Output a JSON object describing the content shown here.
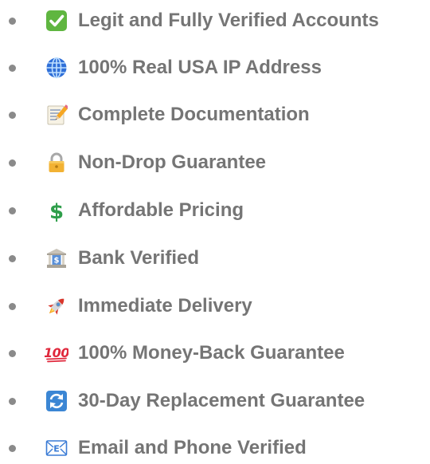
{
  "features": [
    {
      "label": "Legit and Fully Verified Accounts",
      "icon": "check-mark-icon"
    },
    {
      "label": "100% Real USA IP Address",
      "icon": "globe-icon"
    },
    {
      "label": "Complete Documentation",
      "icon": "memo-icon"
    },
    {
      "label": "Non-Drop Guarantee",
      "icon": "lock-icon"
    },
    {
      "label": "Affordable Pricing",
      "icon": "dollar-icon"
    },
    {
      "label": "Bank Verified",
      "icon": "bank-icon"
    },
    {
      "label": "Immediate Delivery",
      "icon": "rocket-icon"
    },
    {
      "label": "100% Money-Back Guarantee",
      "icon": "hundred-points-icon"
    },
    {
      "label": "30-Day Replacement Guarantee",
      "icon": "repeat-arrows-icon"
    },
    {
      "label": "Email and Phone Verified",
      "icon": "email-icon"
    }
  ],
  "colors": {
    "text": "#757575",
    "bullet": "#8a8a8a",
    "check_green": "#5fb640",
    "globe_blue": "#2f6fd8",
    "lock_gold": "#f2b233",
    "dollar_green": "#2e9e4a",
    "rocket_red": "#d9362b",
    "hundred_red": "#e0283c",
    "repeat_blue": "#3b86d4",
    "email_blue": "#3a7bd5"
  }
}
